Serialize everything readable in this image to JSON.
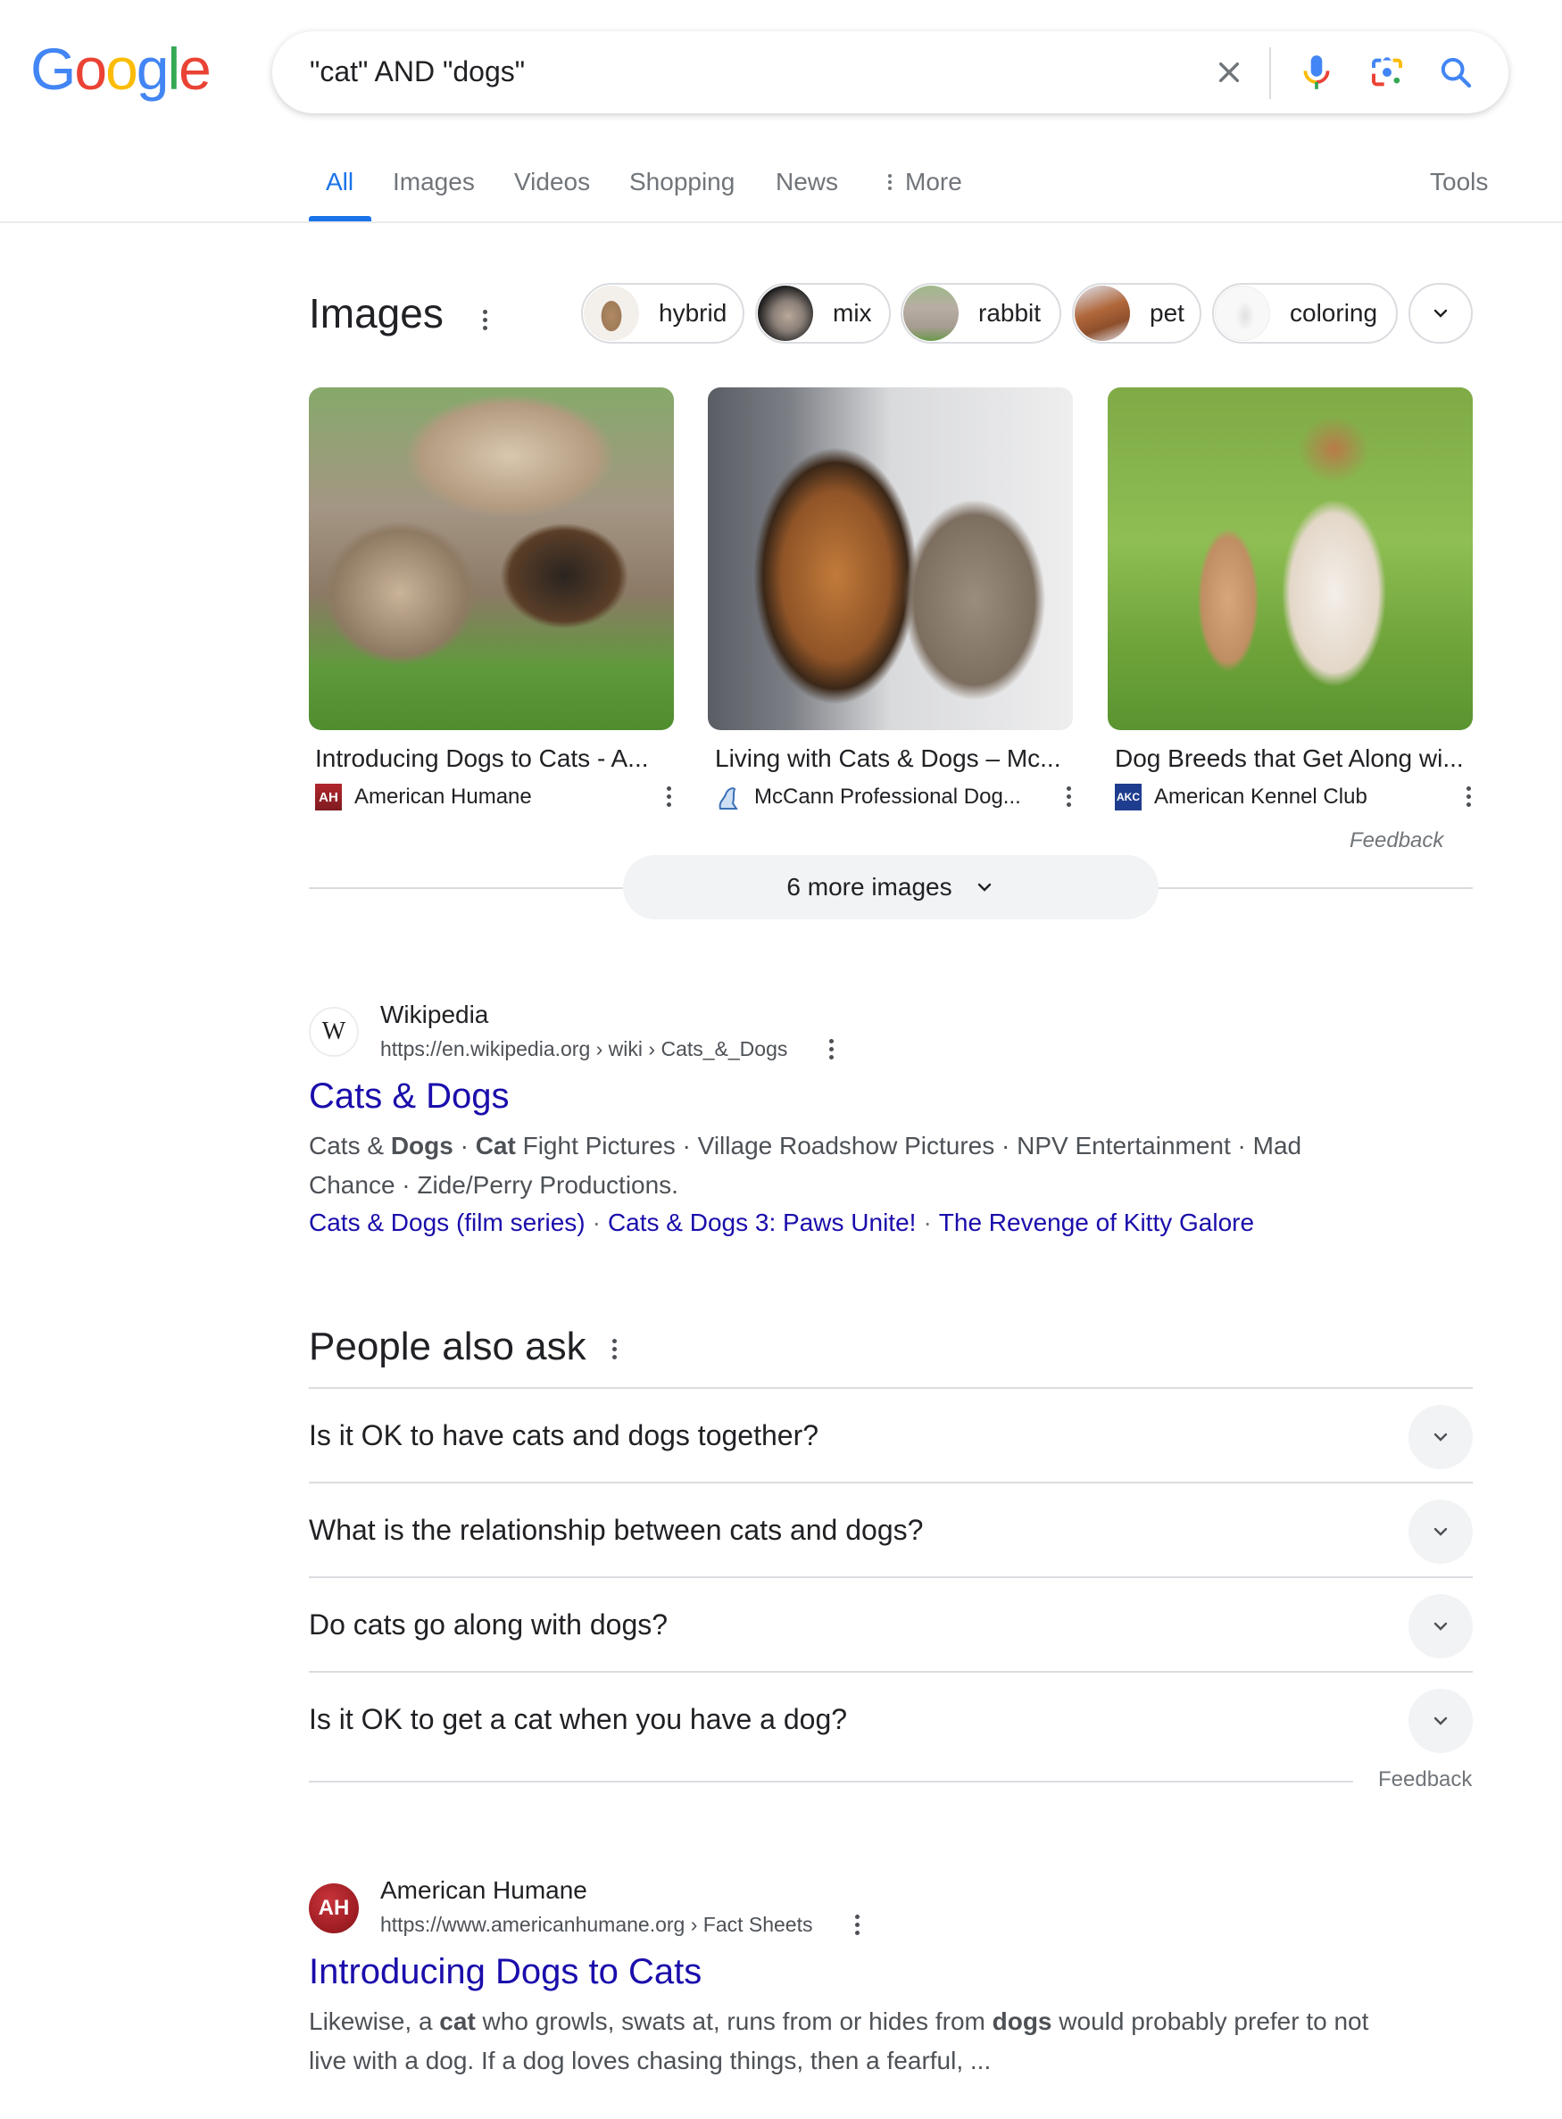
{
  "header": {
    "logo_letters": [
      {
        "char": "G",
        "color": "#4285f4"
      },
      {
        "char": "o",
        "color": "#ea4335"
      },
      {
        "char": "o",
        "color": "#fbbc05"
      },
      {
        "char": "g",
        "color": "#4285f4"
      },
      {
        "char": "l",
        "color": "#34a853"
      },
      {
        "char": "e",
        "color": "#ea4335"
      }
    ],
    "search_query": "\"cat\" AND \"dogs\"",
    "icons": [
      "clear-icon",
      "voice-search-icon",
      "lens-icon",
      "search-icon"
    ]
  },
  "tabs": {
    "items": [
      {
        "label": "All",
        "active": true
      },
      {
        "label": "Images",
        "active": false
      },
      {
        "label": "Videos",
        "active": false
      },
      {
        "label": "Shopping",
        "active": false
      },
      {
        "label": "News",
        "active": false
      },
      {
        "label": "More",
        "active": false
      }
    ],
    "tools_label": "Tools"
  },
  "images_section": {
    "heading": "Images",
    "chips": [
      {
        "label": "hybrid"
      },
      {
        "label": "mix"
      },
      {
        "label": "rabbit"
      },
      {
        "label": "pet"
      },
      {
        "label": "coloring"
      }
    ],
    "results": [
      {
        "title": "Introducing Dogs to Cats - A...",
        "source": "American Humane",
        "favicon_text": "AH"
      },
      {
        "title": "Living with Cats & Dogs – Mc...",
        "source": "McCann Professional Dog...",
        "favicon_text": ""
      },
      {
        "title": "Dog Breeds that Get Along wi...",
        "source": "American Kennel Club",
        "favicon_text": "AKC"
      }
    ],
    "feedback_label": "Feedback",
    "more_images_label": "6 more images"
  },
  "result_wikipedia": {
    "site_name": "Wikipedia",
    "favicon_text": "W",
    "url": "https://en.wikipedia.org › wiki › Cats_&_Dogs",
    "title": "Cats & Dogs",
    "snippet_line1": [
      {
        "text": "Cats & ",
        "bold": false
      },
      {
        "text": "Dogs",
        "bold": true
      },
      {
        "text": " · ",
        "bold": false
      },
      {
        "text": "Cat",
        "bold": true
      },
      {
        "text": " Fight Pictures · Village Roadshow Pictures · NPV Entertainment · Mad",
        "bold": false
      }
    ],
    "snippet_line2": "Chance · Zide/Perry Productions.",
    "sitelinks": [
      "Cats & Dogs (film series)",
      "Cats & Dogs 3: Paws Unite!",
      "The Revenge of Kitty Galore"
    ]
  },
  "people_also_ask": {
    "heading": "People also ask",
    "questions": [
      "Is it OK to have cats and dogs together?",
      "What is the relationship between cats and dogs?",
      "Do cats go along with dogs?",
      "Is it OK to get a cat when you have a dog?"
    ],
    "feedback_label": "Feedback"
  },
  "result_american_humane": {
    "site_name": "American Humane",
    "favicon_text": "AH",
    "url": "https://www.americanhumane.org › Fact Sheets",
    "title": "Introducing Dogs to Cats",
    "snippet_line1": [
      {
        "text": "Likewise, a ",
        "bold": false
      },
      {
        "text": "cat",
        "bold": true
      },
      {
        "text": " who growls, swats at, runs from or hides from ",
        "bold": false
      },
      {
        "text": "dogs",
        "bold": true
      },
      {
        "text": " would probably prefer to not",
        "bold": false
      }
    ],
    "snippet_line2": "live with a dog. If a dog loves chasing things, then a fearful, ..."
  },
  "colors": {
    "accent_blue": "#1a73e8",
    "link_blue": "#1a0dab",
    "text_primary": "#202124",
    "text_secondary": "#4d5156",
    "text_muted": "#70757a"
  }
}
